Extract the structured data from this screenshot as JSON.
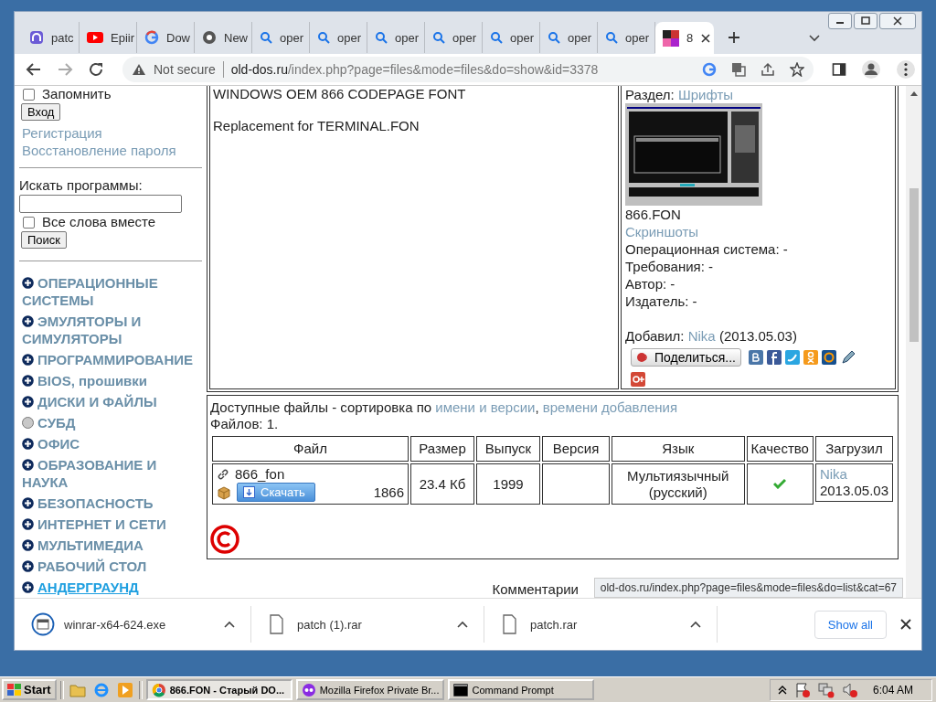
{
  "tabs": [
    {
      "label": "patc",
      "kind": "app",
      "selected": false
    },
    {
      "label": "Epiir",
      "kind": "video",
      "selected": false
    },
    {
      "label": "Dow",
      "kind": "google",
      "selected": false
    },
    {
      "label": "New",
      "kind": "chrome",
      "selected": false
    },
    {
      "label": "oper",
      "kind": "search",
      "selected": false
    },
    {
      "label": "oper",
      "kind": "search",
      "selected": false
    },
    {
      "label": "oper",
      "kind": "search",
      "selected": false
    },
    {
      "label": "oper",
      "kind": "search",
      "selected": false
    },
    {
      "label": "oper",
      "kind": "search",
      "selected": false
    },
    {
      "label": "oper",
      "kind": "search",
      "selected": false
    },
    {
      "label": "oper",
      "kind": "search",
      "selected": false
    },
    {
      "label": "8",
      "kind": "dos",
      "selected": true
    }
  ],
  "address": {
    "security": "Not secure",
    "host": "old-dos.ru",
    "path": "/index.php?page=files&mode=files&do=show&id=3378"
  },
  "sidebar": {
    "remember": "Запомнить",
    "remember_checked": false,
    "login_button": "Вход",
    "links": [
      "Регистрация",
      "Восстановление пароля"
    ],
    "search_label": "Искать программы:",
    "all_words": {
      "label": "Все слова вместе",
      "checked": false
    },
    "search_button": "Поиск",
    "categories": [
      {
        "label": "ОПЕРАЦИОННЫЕ СИСТЕМЫ",
        "kind": "plus",
        "hovered": false
      },
      {
        "label": "ЭМУЛЯТОРЫ И СИМУЛЯТОРЫ",
        "kind": "plus",
        "hovered": false
      },
      {
        "label": "ПРОГРАММИРОВАНИЕ",
        "kind": "plus",
        "hovered": false
      },
      {
        "label": "BIOS, прошивки",
        "kind": "plus",
        "hovered": false
      },
      {
        "label": "ДИСКИ И ФАЙЛЫ",
        "kind": "plus",
        "hovered": false
      },
      {
        "label": "СУБД",
        "kind": "dot",
        "hovered": false
      },
      {
        "label": "ОФИС",
        "kind": "plus",
        "hovered": false
      },
      {
        "label": "ОБРАЗОВАНИЕ И НАУКА",
        "kind": "plus",
        "hovered": false
      },
      {
        "label": "БЕЗОПАСНОСТЬ",
        "kind": "plus",
        "hovered": false
      },
      {
        "label": "ИНТЕРНЕТ И СЕТИ",
        "kind": "plus",
        "hovered": false
      },
      {
        "label": "МУЛЬТИМЕДИА",
        "kind": "plus",
        "hovered": false
      },
      {
        "label": "РАБОЧИЙ СТОЛ",
        "kind": "plus",
        "hovered": false
      },
      {
        "label": "АНДЕРГРАУНД",
        "kind": "plus",
        "hovered": true
      }
    ]
  },
  "description": [
    "WINDOWS OEM 866 CODEPAGE FONT",
    "Replacement for TERMINAL.FON"
  ],
  "info": {
    "section_label": "Раздел:",
    "section_link": "Шрифты",
    "caption": "866.FON",
    "screenshots_link": "Скриншоты",
    "fields": [
      "Операционная система: -",
      "Требования: -",
      "Автор: -",
      "Издатель: -"
    ],
    "added_label": "Добавил:",
    "added_user": "Nika",
    "added_date": "(2013.05.03)",
    "share_button": "Поделиться..."
  },
  "files": {
    "heading": "Доступные файлы - сортировка по",
    "sort_links": [
      "имени и версии",
      "времени добавления"
    ],
    "sort_separator": ",",
    "count": "Файлов: 1.",
    "columns": [
      "Файл",
      "Размер",
      "Выпуск",
      "Версия",
      "Язык",
      "Качество",
      "Загрузил"
    ],
    "rows": [
      {
        "file": "866_fon",
        "download_button": "Скачать",
        "downloads": "1866",
        "size": "23.4 Кб",
        "year": "1999",
        "language": "Мультиязычный (русский)",
        "quality_ok": true,
        "uploader": "Nika",
        "date": "2013.05.03"
      }
    ]
  },
  "comments": "Комментарии",
  "status_url": "old-dos.ru/index.php?page=files&mode=files&do=list&cat=67",
  "downloads": [
    {
      "name": "winrar-x64-624.exe",
      "kind": "exe"
    },
    {
      "name": "patch (1).rar",
      "kind": "file"
    },
    {
      "name": "patch.rar",
      "kind": "file"
    }
  ],
  "show_all": "Show all",
  "taskbar": {
    "start": "Start",
    "tasks": [
      {
        "label": "866.FON - Старый DO...",
        "kind": "chrome",
        "selected": true
      },
      {
        "label": "Mozilla Firefox Private Br...",
        "kind": "firefox",
        "selected": false
      },
      {
        "label": "Command Prompt",
        "kind": "cmd",
        "selected": false
      }
    ],
    "time": "6:04 AM"
  }
}
